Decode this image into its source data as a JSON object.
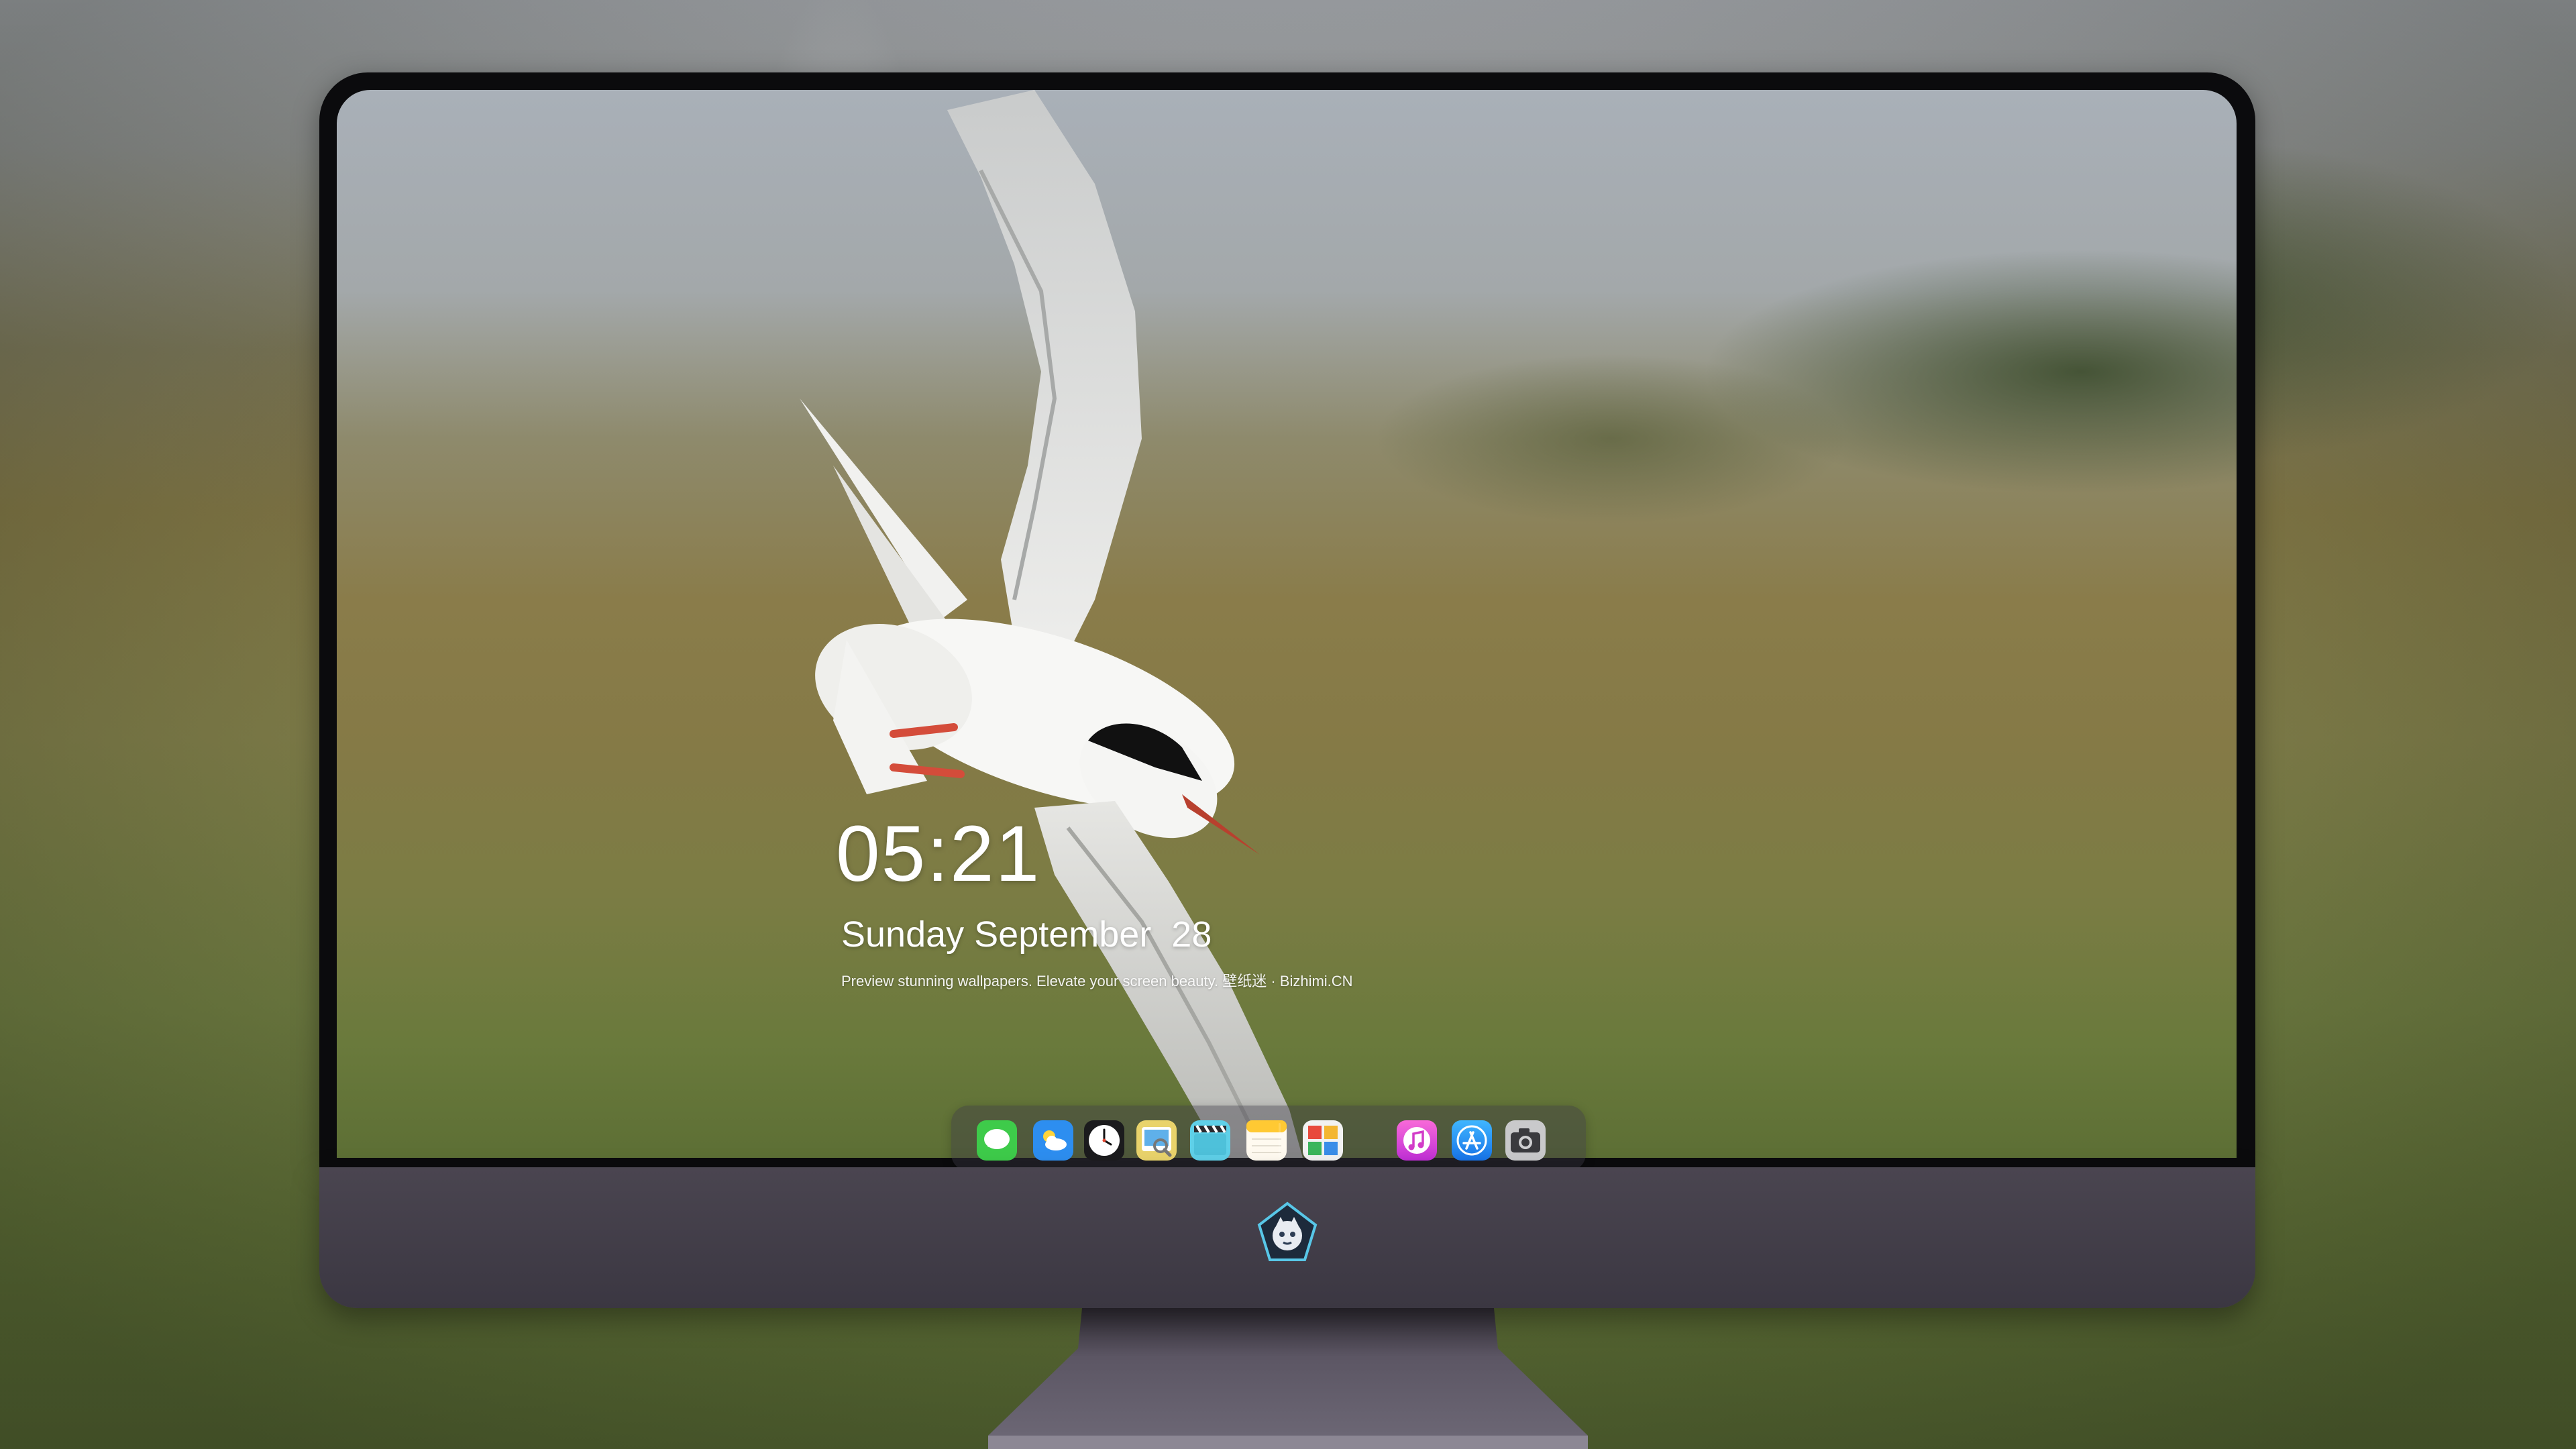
{
  "lock_screen": {
    "time": "05:21",
    "weekday_month": "Sunday September",
    "day": "28",
    "tagline": "Preview stunning wallpapers. Elevate your screen beauty. 壁纸迷 · Bizhimi.CN"
  },
  "dock": {
    "apps": [
      {
        "icon": "messages-icon"
      },
      {
        "icon": "weather-icon"
      },
      {
        "icon": "clock-icon"
      },
      {
        "icon": "preview-icon"
      },
      {
        "icon": "video-clapper-icon"
      },
      {
        "icon": "notes-icon"
      },
      {
        "icon": "photo-gallery-icon"
      },
      {
        "icon": "music-icon"
      },
      {
        "icon": "app-store-icon"
      },
      {
        "icon": "camera-icon"
      }
    ]
  },
  "colors": {
    "messages": "#3ecb4a",
    "weather": "#2d8ef0",
    "music": "#f03fb4",
    "app_store": "#1c8cf0",
    "monitor_chin": "#3f3a45"
  }
}
